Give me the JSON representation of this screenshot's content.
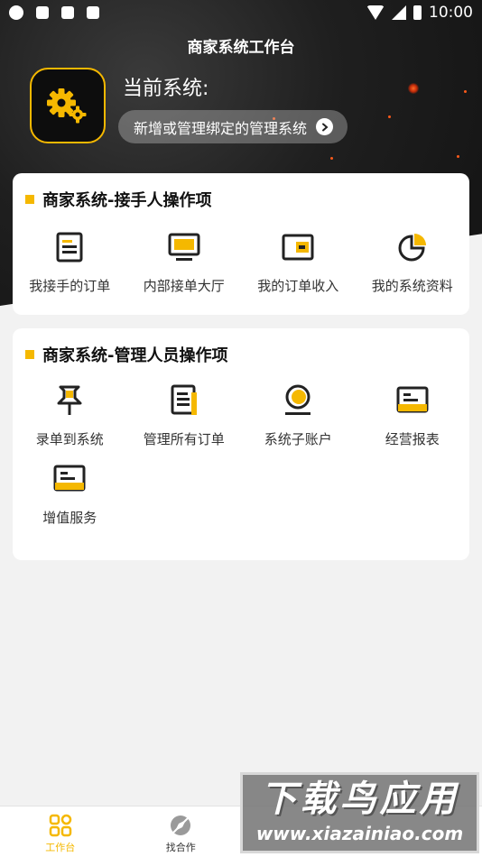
{
  "status_bar": {
    "time": "10:00"
  },
  "header": {
    "title": "商家系统工作台",
    "current_system_label": "当前系统:",
    "manage_button_label": "新增或管理绑定的管理系统"
  },
  "section_handler": {
    "title": "商家系统-接手人操作项",
    "items": [
      {
        "label": "我接手的订单",
        "icon": "document-icon"
      },
      {
        "label": "内部接单大厅",
        "icon": "monitor-icon"
      },
      {
        "label": "我的订单收入",
        "icon": "wallet-icon"
      },
      {
        "label": "我的系统资料",
        "icon": "pie-chart-icon"
      }
    ]
  },
  "section_admin": {
    "title": "商家系统-管理人员操作项",
    "items": [
      {
        "label": "录单到系统",
        "icon": "pin-icon"
      },
      {
        "label": "管理所有订单",
        "icon": "list-document-icon"
      },
      {
        "label": "系统子账户",
        "icon": "user-account-icon"
      },
      {
        "label": "经营报表",
        "icon": "report-icon"
      },
      {
        "label": "增值服务",
        "icon": "service-icon"
      }
    ]
  },
  "bottom_nav": {
    "items": [
      {
        "label": "工作台",
        "icon": "grid-icon",
        "active": true
      },
      {
        "label": "找合作",
        "icon": "compass-icon",
        "active": false
      }
    ]
  },
  "watermark": {
    "title": "下载鸟应用",
    "url": "www.xiazainiao.com"
  },
  "colors": {
    "accent": "#f5b800",
    "dark": "#1a1a1a",
    "background": "#f2f2f2"
  }
}
